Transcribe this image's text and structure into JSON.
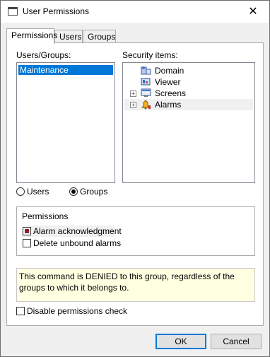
{
  "window": {
    "title": "User Permissions",
    "close_glyph": "✕"
  },
  "tabs": [
    {
      "label": "Permissions",
      "active": true
    },
    {
      "label": "Users",
      "active": false
    },
    {
      "label": "Groups",
      "active": false
    }
  ],
  "users_groups": {
    "label": "Users/Groups:",
    "items": [
      {
        "label": "Maintenance",
        "selected": true
      }
    ]
  },
  "security_items": {
    "label": "Security items:",
    "items": [
      {
        "label": "Domain",
        "icon": "domain-icon",
        "expandable": false
      },
      {
        "label": "Viewer",
        "icon": "viewer-icon",
        "expandable": false
      },
      {
        "label": "Screens",
        "icon": "screens-icon",
        "expandable": true
      },
      {
        "label": "Alarms",
        "icon": "alarms-icon",
        "expandable": true
      }
    ]
  },
  "mode": {
    "users_label": "Users",
    "groups_label": "Groups",
    "selected": "Groups"
  },
  "permissions": {
    "title": "Permissions",
    "items": [
      {
        "label": "Alarm acknowledgment",
        "state": "indeterminate"
      },
      {
        "label": "Delete unbound alarms",
        "state": "unchecked"
      }
    ]
  },
  "info_text": "This command is DENIED to this group, regardless of the groups to which it belongs to.",
  "disable_check_label": "Disable permissions check",
  "buttons": {
    "ok": "OK",
    "cancel": "Cancel"
  },
  "expander_glyph": "+",
  "colors": {
    "selection": "#0078d7",
    "info_bg": "#ffffe1",
    "deny_mark": "#8b2030"
  }
}
